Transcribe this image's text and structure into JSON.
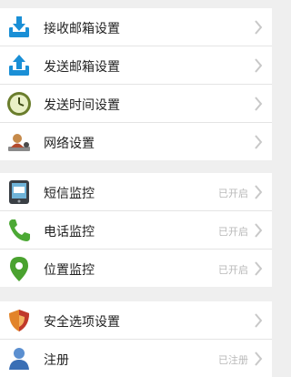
{
  "settings": {
    "email_group": [
      {
        "label": "接收邮箱设置",
        "icon": "download-tray-icon"
      },
      {
        "label": "发送邮箱设置",
        "icon": "upload-tray-icon"
      },
      {
        "label": "发送时间设置",
        "icon": "clock-icon"
      },
      {
        "label": "网络设置",
        "icon": "network-user-icon"
      }
    ],
    "monitor_group": [
      {
        "label": "短信监控",
        "status": "已开启",
        "icon": "sms-phone-icon"
      },
      {
        "label": "电话监控",
        "status": "已开启",
        "icon": "phone-handset-icon"
      },
      {
        "label": "位置监控",
        "status": "已开启",
        "icon": "location-pin-icon"
      }
    ],
    "account_group": [
      {
        "label": "安全选项设置",
        "icon": "security-shield-icon"
      },
      {
        "label": "注册",
        "status": "已注册",
        "icon": "user-icon"
      }
    ]
  },
  "colors": {
    "background": "#efefef",
    "row_background": "#ffffff",
    "status_text": "#b9b9b9",
    "chevron": "#c8c8c8"
  }
}
